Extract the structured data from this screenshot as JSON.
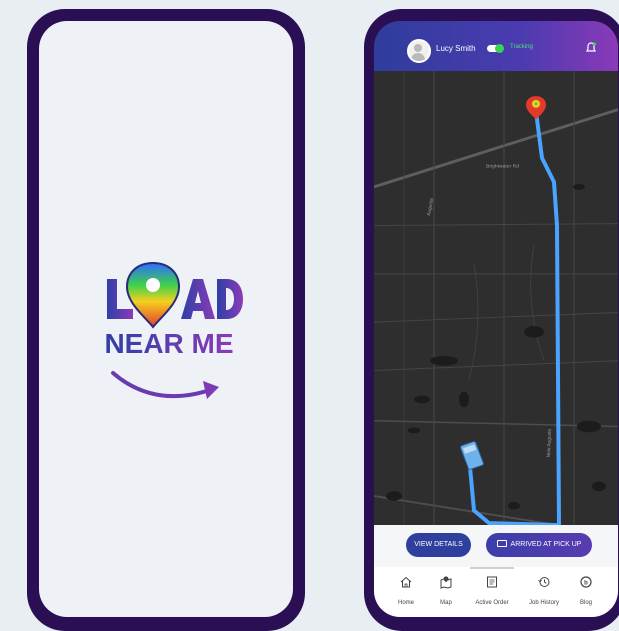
{
  "splash": {
    "logo_text": {
      "line1": "LOAD",
      "line2": "NEAR ME"
    }
  },
  "app": {
    "header": {
      "user_name": "Lucy Smith",
      "tracking_label": "Tracking",
      "tracking_on": true,
      "icon": "notification-bell-icon"
    },
    "map": {
      "roads": [
        "Augusta",
        "Brightwater Rd",
        "New Augusta"
      ]
    },
    "actions": {
      "view_details_label": "VIEW DETAILS",
      "arrived_label": "ARRIVED AT PICK UP"
    },
    "nav": [
      {
        "label": "Home",
        "icon": "home-icon"
      },
      {
        "label": "Map",
        "icon": "map-icon"
      },
      {
        "label": "Active Order",
        "icon": "active-order-icon"
      },
      {
        "label": "Job History",
        "icon": "history-icon"
      },
      {
        "label": "Blog",
        "icon": "blog-icon"
      }
    ]
  },
  "colors": {
    "phone_frame": "#2a0f55",
    "header_gradient_start": "#2f3d9c",
    "header_gradient_end": "#8a3ab8",
    "route": "#4aa3ff",
    "button": "#2f3f9e",
    "tracking_on": "#39d353"
  }
}
